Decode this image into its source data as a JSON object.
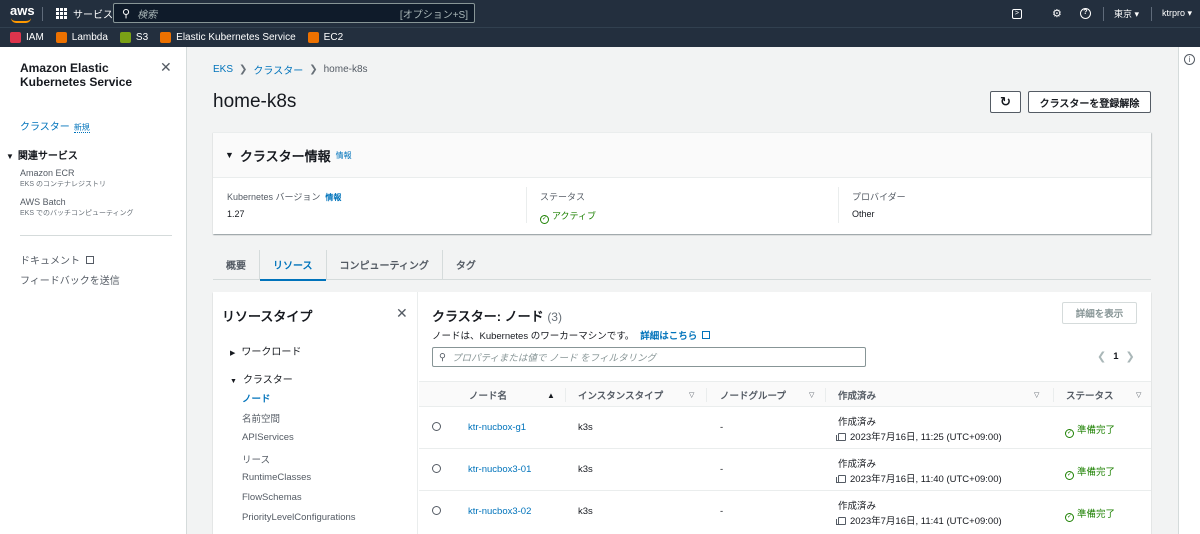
{
  "topbar": {
    "logo": "aws",
    "services_label": "サービス",
    "search_placeholder": "検索",
    "search_shortcut": "[オプション+S]",
    "region": "東京 ▾",
    "account": "ktrpro ▾"
  },
  "bookmarks": [
    {
      "label": "IAM",
      "color": "#dd344c"
    },
    {
      "label": "Lambda",
      "color": "#ed7100"
    },
    {
      "label": "S3",
      "color": "#7aa116"
    },
    {
      "label": "Elastic Kubernetes Service",
      "color": "#ed7100"
    },
    {
      "label": "EC2",
      "color": "#ed7100"
    }
  ],
  "sidebar": {
    "title": "Amazon Elastic Kubernetes Service",
    "clusters_label": "クラスター",
    "new_badge": "新規",
    "related_header": "関連サービス",
    "related": [
      {
        "name": "Amazon ECR",
        "desc": "EKS のコンテナレジストリ"
      },
      {
        "name": "AWS Batch",
        "desc": "EKS でのバッチコンピューティング"
      }
    ],
    "docs_label": "ドキュメント",
    "feedback_label": "フィードバックを送信"
  },
  "breadcrumb": {
    "root": "EKS",
    "middle": "クラスター",
    "current": "home-k8s"
  },
  "page_title": "home-k8s",
  "buttons": {
    "deregister": "クラスターを登録解除"
  },
  "cluster_info": {
    "header": "クラスター情報",
    "info_link": "情報",
    "k8s_version_label": "Kubernetes バージョン",
    "k8s_version_info": "情報",
    "k8s_version": "1.27",
    "status_label": "ステータス",
    "status": "アクティブ",
    "provider_label": "プロバイダー",
    "provider": "Other"
  },
  "tabs": [
    "概要",
    "リソース",
    "コンピューティング",
    "タグ"
  ],
  "resource_types": {
    "title": "リソースタイプ",
    "workload_group": "ワークロード",
    "cluster_group": "クラスター",
    "items": [
      "ノード",
      "名前空間",
      "APIServices",
      "リース",
      "RuntimeClasses",
      "FlowSchemas",
      "PriorityLevelConfigurations"
    ]
  },
  "nodes": {
    "title": "クラスター: ノード",
    "count": "(3)",
    "description": "ノードは、Kubernetes のワーカーマシンです。",
    "learn_more": "詳細はこちら",
    "detail_button": "詳細を表示",
    "filter_placeholder": "プロパティまたは値で ノード をフィルタリング",
    "page": "1",
    "columns": [
      "ノード名",
      "インスタンスタイプ",
      "ノードグループ",
      "作成済み",
      "ステータス"
    ],
    "rows": [
      {
        "name": "ktr-nucbox-g1",
        "instance_type": "k3s",
        "node_group": "-",
        "created_label": "作成済み",
        "created": "2023年7月16日, 11:25 (UTC+09:00)",
        "status": "準備完了"
      },
      {
        "name": "ktr-nucbox3-01",
        "instance_type": "k3s",
        "node_group": "-",
        "created_label": "作成済み",
        "created": "2023年7月16日, 11:40 (UTC+09:00)",
        "status": "準備完了"
      },
      {
        "name": "ktr-nucbox3-02",
        "instance_type": "k3s",
        "node_group": "-",
        "created_label": "作成済み",
        "created": "2023年7月16日, 11:41 (UTC+09:00)",
        "status": "準備完了"
      }
    ]
  }
}
